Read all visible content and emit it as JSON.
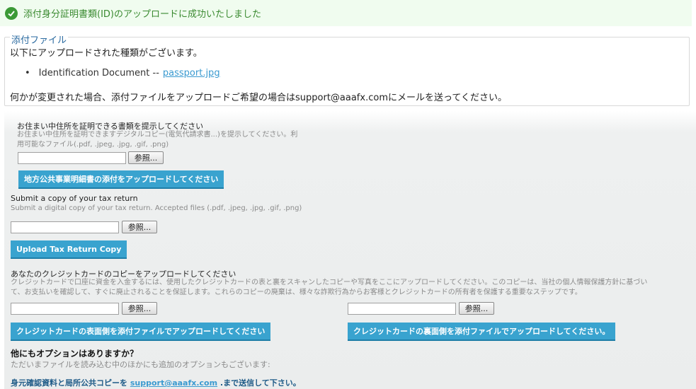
{
  "success": {
    "message": "添付身分証明書類(ID)のアップロードに成功いたしました",
    "icon": "checkmark-icon",
    "color": "#3b9a36"
  },
  "attachments": {
    "legend": "添付ファイル",
    "intro": "以下にアップロードされた種類がございます。",
    "items": [
      {
        "type": "Identification Document --",
        "file": "passport.jpg"
      }
    ],
    "note": "何かが変更された場合、添付ファイルをアップロードご希望の場合はsupport@aaafx.comにメールを送ってください。"
  },
  "sections": {
    "address": {
      "title": "お住まい中住所を証明できる書類を提示してください",
      "desc_line1": "お住まい中住所を証明できますデジタルコピー(電気代請求書...)を提示してください。利",
      "desc_line2": "用可能なファイル(.pdf, .jpeg, .jpg, .gif, .png)",
      "browse_label": "参照...",
      "upload_label": "地方公共事業明細書の添付をアップロードしてください"
    },
    "tax": {
      "title": "Submit a copy of your tax return",
      "desc": "Submit a digital copy of your tax return. Accepted files (.pdf, .jpeg, .jpg, .gif, .png)",
      "browse_label": "参照...",
      "upload_label": "Upload Tax Return Copy"
    },
    "card": {
      "title": "あなたのクレジットカードのコピーをアップロードしてください",
      "desc_line1": "クレジットカードで口座に資金を入金するには、使用したクレジットカードの表と裏をスキャンしたコピーや写真をここにアップロードしてください。このコピーは、当社の個人情報保護方針に基づい",
      "desc_line2": "て、お支払いを確認して、すぐに廃止されることを保証します。これらのコピーの廃棄は、様々な詐欺行為からお客様とクレジットカードの所有者を保護する重要なステップです。",
      "front_browse_label": "参照...",
      "back_browse_label": "参照...",
      "front_upload_label": "クレジットカードの表面側を添付ファイルでアップロードしてください",
      "back_upload_label": "クレジットカードの裏面側を添付ファイルでアップロードしてください。"
    },
    "options": {
      "title": "他にもオプションはありますか？",
      "desc": "ただいまファイルを読み込む中のほかにも追加のオプションもございます:",
      "contact_prefix": "身元確認資料と局所公共コピーを",
      "contact_email": "support@aaafx.com",
      "contact_suffix": ".まで送信して下さい。"
    }
  },
  "colors": {
    "accent_button": "#39a3cf",
    "success_bg": "#f0fcef",
    "link": "#3a9ad0"
  }
}
